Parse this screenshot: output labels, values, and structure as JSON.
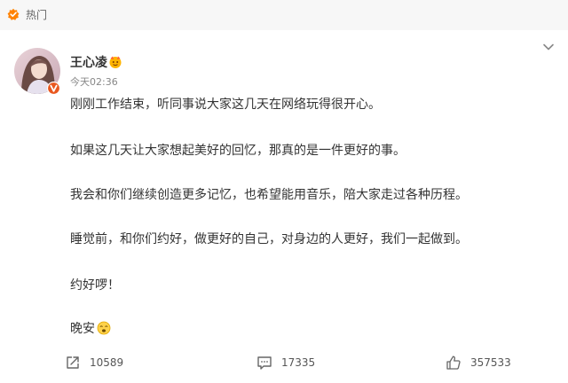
{
  "header": {
    "hot_label": "热门"
  },
  "post": {
    "author": "王心凌",
    "time": "今天02:36",
    "paragraphs": [
      "刚刚工作结束，听同事说大家这几天在网络玩得很开心。",
      "如果这几天让大家想起美好的回忆，那真的是一件更好的事。",
      "我会和你们继续创造更多记忆，也希望能用音乐，陪大家走过各种历程。",
      "睡觉前，和你们约好，做更好的自己，对身边的人更好，我们一起做到。",
      "约好啰！",
      "晚安"
    ]
  },
  "actions": {
    "repost_count": "10589",
    "comment_count": "17335",
    "like_count": "357533"
  },
  "colors": {
    "accent_orange": "#ff8200",
    "verified_badge": "#e9581f"
  },
  "icons": {
    "hot": "hot-badge-icon",
    "more": "chevron-down-icon",
    "verified": "verified-badge-icon",
    "emblem": "member-emblem-icon",
    "repost": "repost-icon",
    "comment": "comment-icon",
    "like": "thumbs-up-icon",
    "sleepy": "sleepy-emoji-icon"
  }
}
